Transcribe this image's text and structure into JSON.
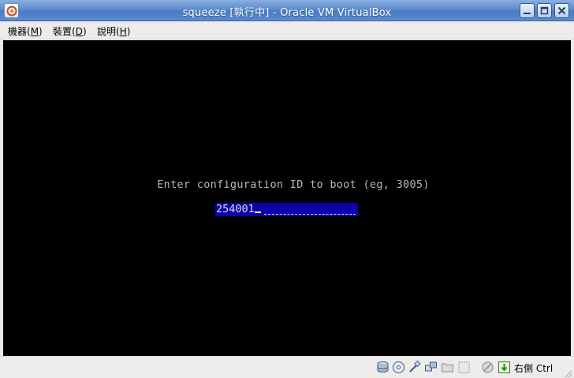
{
  "window": {
    "title": "squeeze [執行中] - Oracle VM VirtualBox"
  },
  "menu": {
    "items": [
      {
        "label": "機器(",
        "key": "M",
        "suffix": ")"
      },
      {
        "label": "裝置(",
        "key": "D",
        "suffix": ")"
      },
      {
        "label": "說明(",
        "key": "H",
        "suffix": ")"
      }
    ]
  },
  "console": {
    "prompt": "Enter configuration ID to boot (eg, 3005)",
    "input_value": "254001"
  },
  "statusbar": {
    "icons": [
      "hard-disk-icon",
      "optical-disc-icon",
      "usb-icon",
      "network-icon",
      "shared-folders-icon",
      "display-icon",
      "mouse-integration-icon",
      "keyboard-capture-icon"
    ],
    "host_key": "右側 Ctrl"
  }
}
